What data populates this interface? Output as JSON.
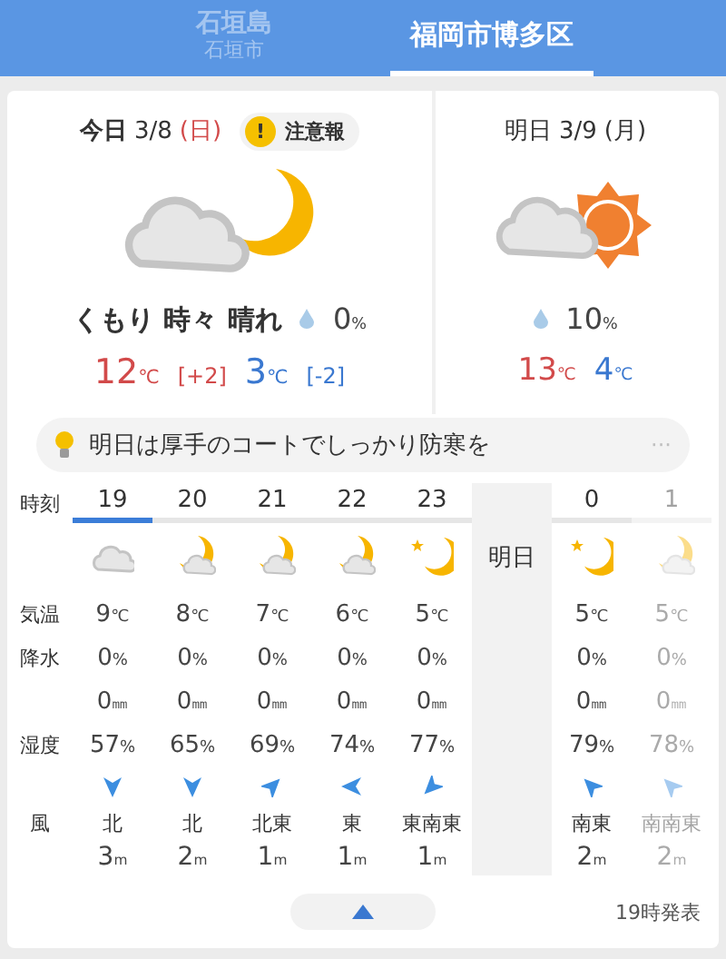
{
  "header": {
    "tabs": [
      {
        "name": "石垣島",
        "sub": "石垣市",
        "selected": false
      },
      {
        "name": "福岡市博多区",
        "selected": true
      }
    ]
  },
  "today": {
    "label": "今日",
    "date": "3/8",
    "weekday": "(日)",
    "alert": {
      "mark": "!",
      "label": "注意報"
    },
    "kind": "cloud-moon",
    "weather": "くもり 時々 晴れ",
    "precip": "0%",
    "high": "12℃",
    "high_diff": "[+2]",
    "low": "3℃",
    "low_diff": "[-2]"
  },
  "tomorrow": {
    "label": "明日",
    "date": "3/9",
    "weekday": "(月)",
    "kind": "cloud-sun",
    "precip": "10%",
    "high": "13℃",
    "low": "4℃"
  },
  "tip": {
    "text": "明日は厚手のコートでしっかり防寒を",
    "more": "···"
  },
  "table": {
    "labels": {
      "time": "時刻",
      "temp": "気温",
      "precip": "降水",
      "humidity": "湿度",
      "wind": "風"
    },
    "hours": [
      {
        "hour": "19",
        "selected": true,
        "kind": "cloud",
        "temp": "9℃",
        "precip": "0%",
        "rain": "0㎜",
        "humidity": "57%",
        "wind": {
          "kind": "S"
        },
        "wind_dir": "北",
        "wind_speed": "3m"
      },
      {
        "hour": "20",
        "selected": false,
        "kind": "moon-cloud",
        "temp": "8℃",
        "precip": "0%",
        "rain": "0㎜",
        "humidity": "65%",
        "wind": {
          "kind": "S"
        },
        "wind_dir": "北",
        "wind_speed": "2m"
      },
      {
        "hour": "21",
        "selected": false,
        "kind": "moon-cloud",
        "temp": "7℃",
        "precip": "0%",
        "rain": "0㎜",
        "humidity": "69%",
        "wind": {
          "kind": "NE"
        },
        "wind_dir": "北東",
        "wind_speed": "1m"
      },
      {
        "hour": "22",
        "selected": false,
        "kind": "moon-cloud",
        "temp": "6℃",
        "precip": "0%",
        "rain": "0㎜",
        "humidity": "74%",
        "wind": {
          "kind": "W"
        },
        "wind_dir": "東",
        "wind_speed": "1m"
      },
      {
        "hour": "23",
        "selected": false,
        "kind": "moon",
        "temp": "5℃",
        "precip": "0%",
        "rain": "0㎜",
        "humidity": "77%",
        "wind": {
          "kind": "SW"
        },
        "wind_dir": "東南東",
        "wind_speed": "1m"
      }
    ],
    "next_day": {
      "label": "明日",
      "hours": [
        {
          "hour": "0",
          "selected": false,
          "kind": "moon",
          "temp": "5℃",
          "precip": "0%",
          "rain": "0㎜",
          "humidity": "79%",
          "wind": {
            "kind": "NW"
          },
          "wind_dir": "南東",
          "wind_speed": "2m"
        },
        {
          "hour": "1",
          "selected": false,
          "kind": "moon-cloud",
          "temp": "5℃",
          "precip": "0%",
          "rain": "0㎜",
          "humidity": "78%",
          "wind": {
            "kind": "NW"
          },
          "wind_dir": "南南東",
          "wind_speed": "2m"
        }
      ]
    }
  },
  "footer": {
    "issued": "19時発表"
  }
}
